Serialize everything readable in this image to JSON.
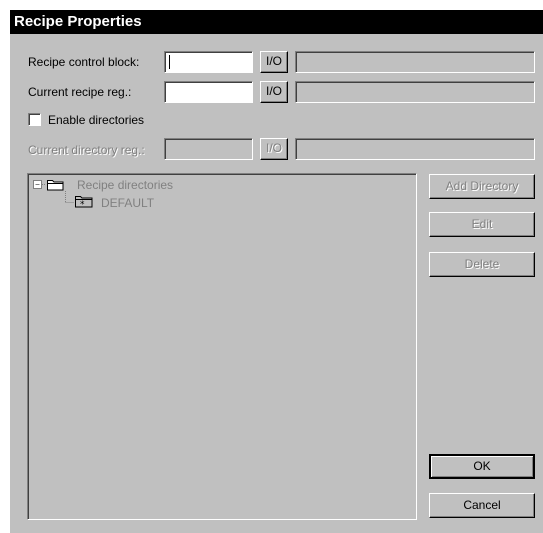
{
  "window": {
    "title": "Recipe Properties"
  },
  "fields": {
    "recipe_control_block": {
      "label": "Recipe control block:",
      "value": "",
      "io_label": "I/O"
    },
    "current_recipe_reg": {
      "label": "Current recipe reg.:",
      "value": "",
      "io_label": "I/O"
    },
    "enable_directories": {
      "label": "Enable directories",
      "checked": false
    },
    "current_directory_reg": {
      "label": "Current directory reg.:",
      "value": "",
      "io_label": "I/O"
    }
  },
  "tree": {
    "root": {
      "label": "Recipe directories",
      "expander": "−"
    },
    "children": [
      {
        "label": "DEFAULT",
        "icon": "folder-star-icon"
      }
    ]
  },
  "buttons": {
    "add_directory": "Add Directory",
    "edit": "Edit",
    "delete": "Delete",
    "ok": "OK",
    "cancel": "Cancel"
  }
}
